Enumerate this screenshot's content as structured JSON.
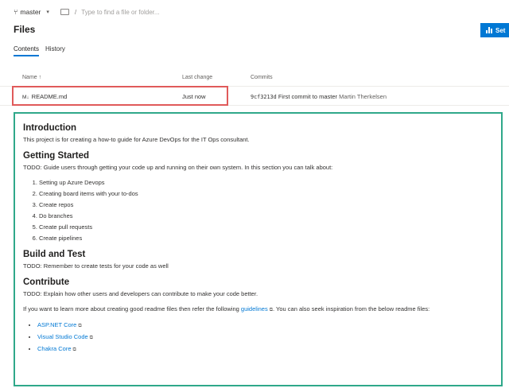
{
  "branch": {
    "name": "master",
    "icon": "branch-icon"
  },
  "path_search": {
    "placeholder": "Type to find a file or folder..."
  },
  "page": {
    "title": "Files"
  },
  "actions": {
    "set_label": "Set"
  },
  "tabs": [
    {
      "label": "Contents"
    },
    {
      "label": "History"
    }
  ],
  "table": {
    "headers": {
      "name": "Name ↑",
      "last_change": "Last change",
      "commits": "Commits"
    },
    "rows": [
      {
        "file_icon": "M↓",
        "name": "README.md",
        "last_change": "Just now",
        "commit_id": "9cf3213d",
        "commit_message": "First commit to master",
        "commit_author": "Martin Therkelsen"
      }
    ]
  },
  "readme": {
    "intro": {
      "heading": "Introduction",
      "text": "This project is for creating a how-to guide for Azure DevOps for the IT Ops consultant."
    },
    "getting_started": {
      "heading": "Getting Started",
      "text": "TODO: Guide users through getting your code up and running on their own system. In this section you can talk about:",
      "items": [
        "Setting up Azure Devops",
        "Creating board items with your to-dos",
        "Create repos",
        "Do branches",
        "Create pull requests",
        "Create pipelines"
      ]
    },
    "build_test": {
      "heading": "Build and Test",
      "text": "TODO: Remember to create tests for your code as well"
    },
    "contribute": {
      "heading": "Contribute",
      "text": "TODO: Explain how other users and developers can contribute to make your code better.",
      "more_before": "If you want to learn more about creating good readme files then refer the following",
      "more_link": "guidelines",
      "more_after": ". You can also seek inspiration from the below readme files:",
      "links": [
        "ASP.NET Core",
        "Visual Studio Code",
        "Chakra Core"
      ]
    }
  },
  "colors": {
    "accent": "#0078d4",
    "highlight_red": "#e05a5a",
    "highlight_green": "#2fa88a"
  }
}
